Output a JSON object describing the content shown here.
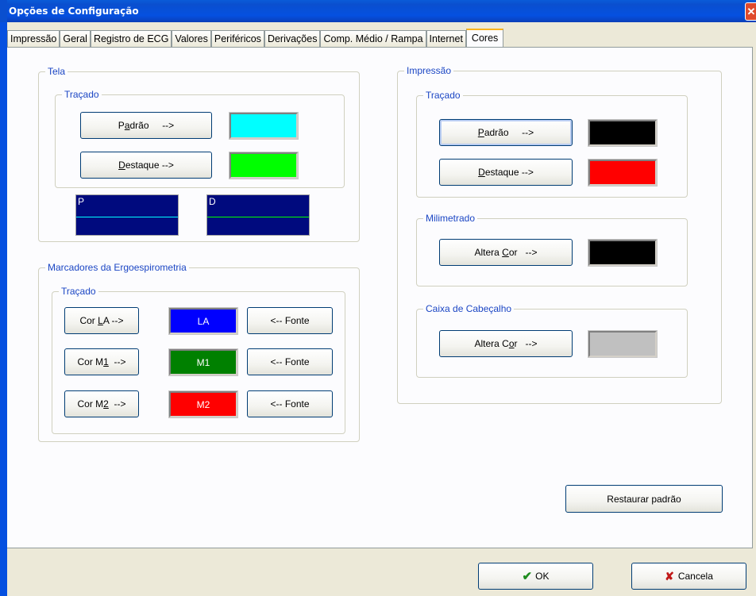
{
  "window": {
    "title": "Opções de Configuração",
    "close_glyph": "✕"
  },
  "tabs": [
    "Impressão",
    "Geral",
    "Registro de ECG",
    "Valores",
    "Periféricos",
    "Derivações",
    "Comp. Médio / Rampa",
    "Internet",
    "Cores"
  ],
  "active_tab": "Cores",
  "tela": {
    "title": "Tela",
    "tracado_title": "Traçado",
    "padrao": {
      "pre": "P",
      "u": "a",
      "post": "drão     -->",
      "color": "#00ffff"
    },
    "destaque": {
      "pre": "",
      "u": "D",
      "post": "estaque -->",
      "color": "#00ff00"
    },
    "preview_p": {
      "letter": "P",
      "bg": "#000a7e",
      "line": "#00ffff"
    },
    "preview_d": {
      "letter": "D",
      "bg": "#000a7e",
      "line": "#00ff00"
    }
  },
  "marcadores": {
    "title": "Marcadores da Ergoespirometria",
    "tracado_title": "Traçado",
    "rows": [
      {
        "pre": "Cor ",
        "u": "L",
        "post": "A -->",
        "swatch_label": "LA",
        "color": "#0000ff",
        "fonte": "<-- Fonte"
      },
      {
        "pre": "Cor M",
        "u": "1",
        "post": "  -->",
        "swatch_label": "M1",
        "color": "#008000",
        "fonte": "<-- Fonte"
      },
      {
        "pre": "Cor M",
        "u": "2",
        "post": "  -->",
        "swatch_label": "M2",
        "color": "#ff0000",
        "fonte": "<-- Fonte"
      }
    ]
  },
  "impressao": {
    "title": "Impressão",
    "tracado_title": "Traçado",
    "padrao": {
      "pre": "",
      "u": "P",
      "post": "adrão     -->",
      "color": "#000000"
    },
    "destaque": {
      "pre": "",
      "u": "D",
      "post": "estaque -->",
      "color": "#ff0000"
    },
    "milimetrado": {
      "title": "Milimetrado",
      "pre": "Altera ",
      "u": "C",
      "post": "or   -->",
      "color": "#000000"
    },
    "cabecalho": {
      "title": "Caixa de Cabeçalho",
      "pre": "Altera C",
      "u": "o",
      "post": "r   -->",
      "color": "#c0c0c0"
    }
  },
  "restore_label": "Restaurar padrão",
  "ok": {
    "icon": "✔",
    "label": "OK",
    "color": "#1e8c1e"
  },
  "cancel": {
    "icon": "✘",
    "label": "Cancela",
    "color": "#c01818"
  }
}
